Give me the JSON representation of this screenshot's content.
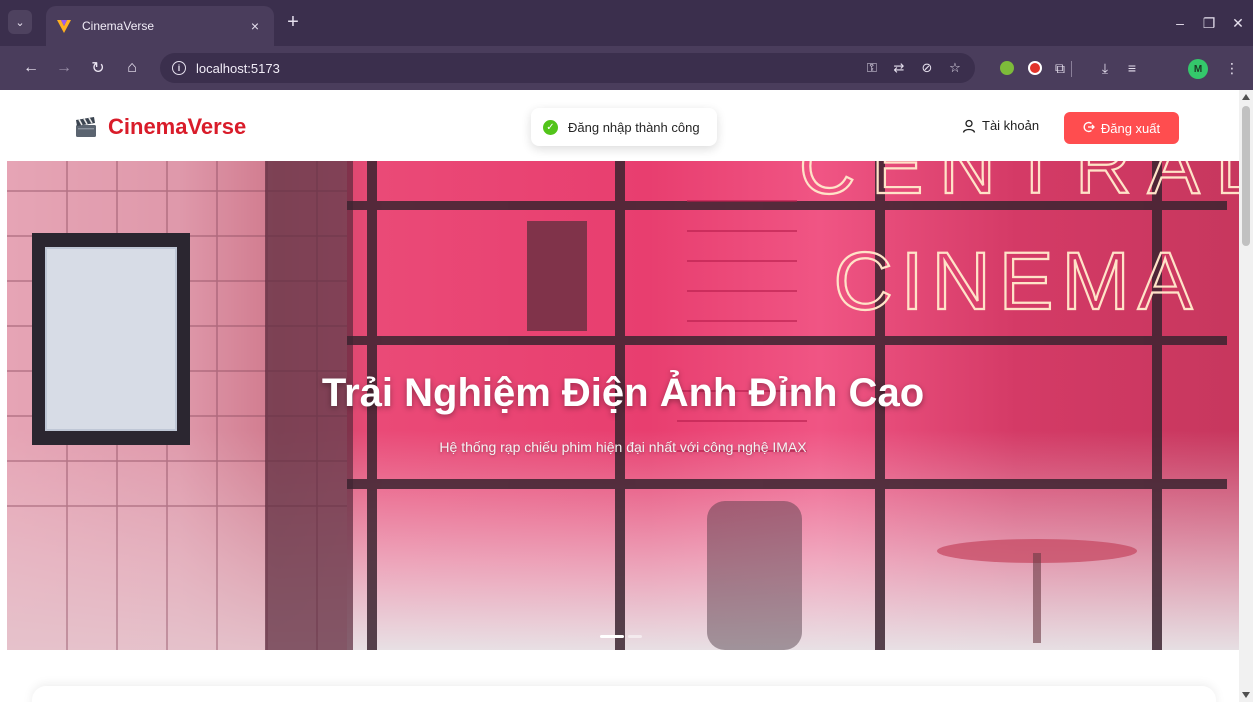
{
  "browser": {
    "tab": {
      "title": "CinemaVerse",
      "close": "×"
    },
    "new_tab": "+",
    "address": {
      "url": "localhost:5173",
      "info": "i"
    },
    "profile_initial": "M",
    "window": {
      "minimize": "–",
      "restore": "❐",
      "close": "✕"
    }
  },
  "header": {
    "brand": "CinemaVerse",
    "account_label": "Tài khoản",
    "logout_label": "Đăng xuất"
  },
  "toast": {
    "message": "Đăng nhập thành công",
    "status_color": "#52c41a"
  },
  "hero": {
    "title": "Trải Nghiệm Điện Ảnh Đỉnh Cao",
    "subtitle": "Hệ thống rạp chiếu phim hiện đại nhất với công nghệ IMAX",
    "slides_total": 2,
    "active_slide": 1,
    "sign_text_1": "CENTRAL",
    "sign_text_2": "CINEMA"
  },
  "colors": {
    "brand": "#d91c2a",
    "logout_button": "#ff4d4f",
    "chrome_frame": "#3b2f4d"
  },
  "icons": [
    "tab-search-icon",
    "favicon-icon",
    "back-icon",
    "forward-icon",
    "reload-icon",
    "home-icon",
    "info-icon",
    "key-icon",
    "translate-icon",
    "eye-off-icon",
    "star-icon",
    "extension-icon",
    "download-icon",
    "media-icon",
    "menu-icon",
    "clapperboard-icon",
    "user-icon",
    "logout-icon",
    "check-circle-icon"
  ]
}
